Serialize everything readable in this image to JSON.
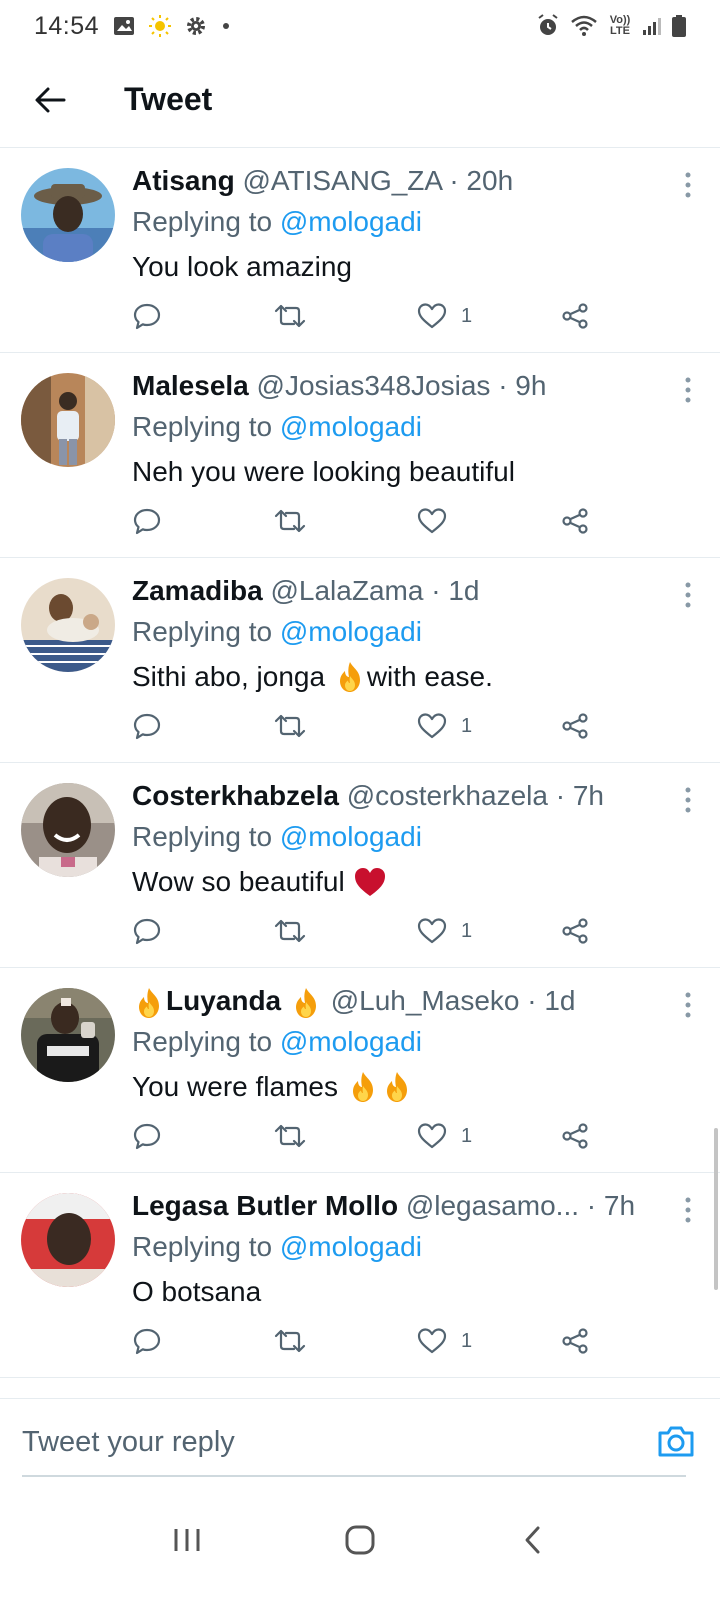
{
  "status_bar": {
    "time": "14:54",
    "left_icons": [
      "image-icon",
      "sun-icon",
      "gear-icon",
      "dot-icon"
    ],
    "right_icons": [
      "alarm-icon",
      "wifi-icon",
      "volte-icon",
      "signal-icon",
      "battery-icon"
    ],
    "volte_label": "Vo)) LTE"
  },
  "header": {
    "title": "Tweet",
    "back_icon": "arrow-left-icon"
  },
  "replying_label": "Replying to",
  "replies": [
    {
      "name": "Atisang",
      "handle": "@ATISANG_ZA",
      "sep": "·",
      "time": "20h",
      "mention": "@mologadi",
      "text": "You look amazing",
      "like_count": "1",
      "avatar_color": "#5aa0c8"
    },
    {
      "name": "Malesela",
      "handle": "@Josias348Josias",
      "sep": "·",
      "time": "9h",
      "mention": "@mologadi",
      "text": "Neh you were looking beautiful",
      "like_count": "",
      "avatar_color": "#8a6b4c"
    },
    {
      "name": "Zamadiba",
      "handle": "@LalaZama",
      "sep": "·",
      "time": "1d",
      "mention": "@mologadi",
      "text_before": "Sithi abo, jonga ",
      "text_after": "with ease.",
      "like_count": "1",
      "avatar_color": "#c9b59a"
    },
    {
      "name": "Costerkhabzela",
      "handle": "@costerkhazela",
      "sep": "·",
      "time": "7h",
      "mention": "@mologadi",
      "text": "Wow so beautiful ",
      "like_count": "1",
      "avatar_color": "#4a4038"
    },
    {
      "name": "Luyanda",
      "handle": "@Luh_Maseko",
      "sep": "·",
      "time": "1d",
      "mention": "@mologadi",
      "text": "You were flames ",
      "like_count": "1",
      "avatar_color": "#3a3a3a"
    },
    {
      "name": "Legasa Butler Mollo",
      "handle": "@legasamo...",
      "sep": "·",
      "time": "7h",
      "mention": "@mologadi",
      "text": "O botsana",
      "like_count": "1",
      "avatar_color": "#c43a3a"
    }
  ],
  "composer": {
    "placeholder": "Tweet your reply",
    "camera_icon": "camera-icon"
  },
  "nav_bar": {
    "icons": [
      "recents-icon",
      "home-icon",
      "back-icon"
    ]
  },
  "colors": {
    "accent": "#1d9bf0",
    "text_primary": "#0f1419",
    "text_secondary": "#536471",
    "divider": "#e6ecf0",
    "heart": "#c8102e",
    "fire": "#f59e0b"
  }
}
